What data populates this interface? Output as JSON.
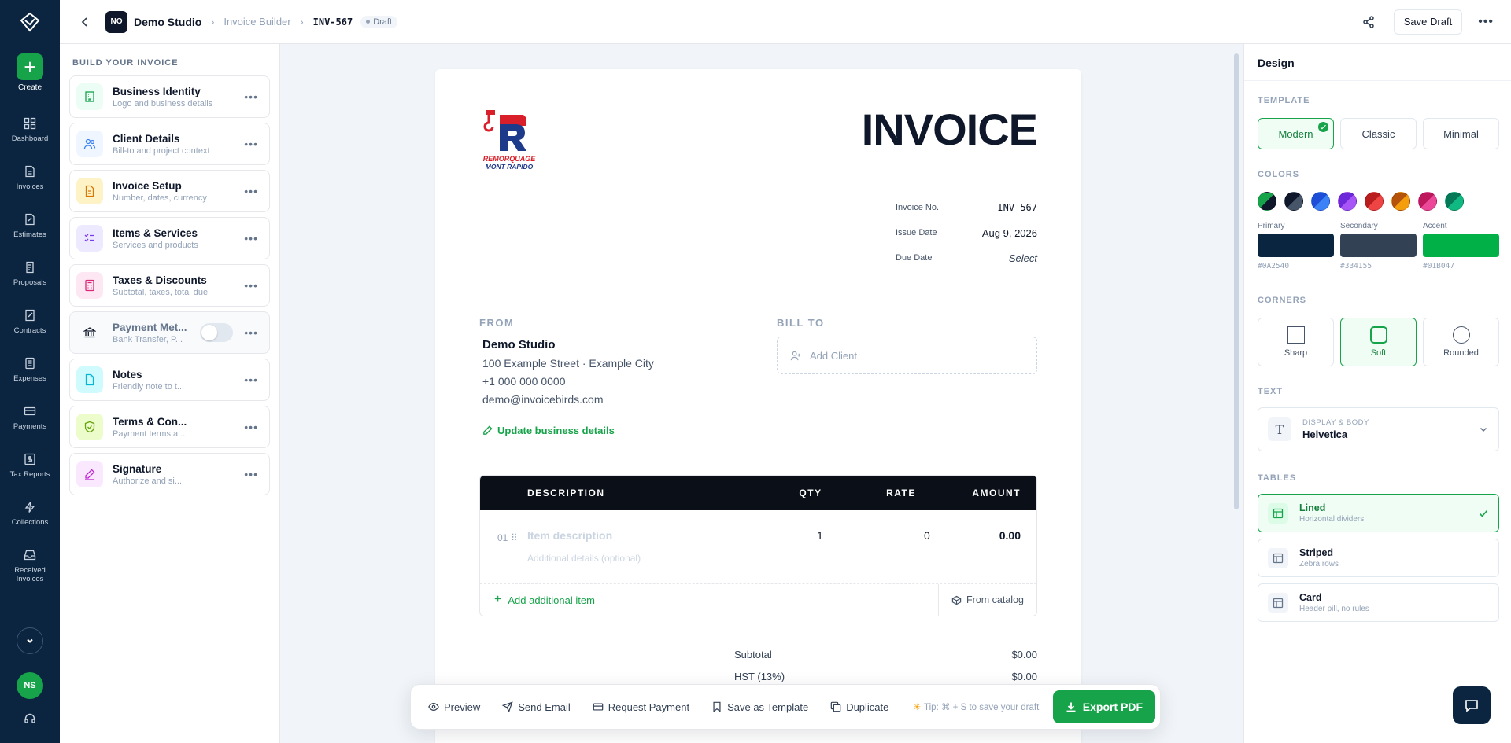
{
  "rail": {
    "create_label": "Create",
    "items": [
      {
        "label": "Dashboard",
        "icon": "dashboard-icon"
      },
      {
        "label": "Invoices",
        "icon": "invoice-icon"
      },
      {
        "label": "Estimates",
        "icon": "estimate-icon"
      },
      {
        "label": "Proposals",
        "icon": "proposal-icon"
      },
      {
        "label": "Contracts",
        "icon": "contract-icon"
      },
      {
        "label": "Expenses",
        "icon": "expense-icon"
      },
      {
        "label": "Payments",
        "icon": "card-icon"
      },
      {
        "label": "Tax Reports",
        "icon": "dollar-icon"
      },
      {
        "label": "Collections",
        "icon": "bolt-icon"
      },
      {
        "label": "Received Invoices",
        "icon": "inbox-icon"
      }
    ],
    "avatar_initials": "NS"
  },
  "topbar": {
    "org_initials": "NO",
    "org_name": "Demo Studio",
    "breadcrumb_builder": "Invoice Builder",
    "invoice_id": "INV-567",
    "status": "Draft",
    "save_draft_label": "Save Draft"
  },
  "build": {
    "title": "BUILD YOUR INVOICE",
    "items": [
      {
        "title": "Business Identity",
        "sub": "Logo and business details",
        "color": "#ecfdf5",
        "stroke": "#16a34a"
      },
      {
        "title": "Client Details",
        "sub": "Bill-to and project context",
        "color": "#eff6ff",
        "stroke": "#3b82f6"
      },
      {
        "title": "Invoice Setup",
        "sub": "Number, dates, currency",
        "color": "#fef3c7",
        "stroke": "#d97706"
      },
      {
        "title": "Items & Services",
        "sub": "Services and products",
        "color": "#ede9fe",
        "stroke": "#7c3aed"
      },
      {
        "title": "Taxes & Discounts",
        "sub": "Subtotal, taxes, total due",
        "color": "#fce7f3",
        "stroke": "#db2777"
      },
      {
        "title": "Payment Met...",
        "sub": "Bank Transfer, P...",
        "color": "#f8fafc",
        "stroke": "#0f172a"
      },
      {
        "title": "Notes",
        "sub": "Friendly note to t...",
        "color": "#cffafe",
        "stroke": "#06b6d4"
      },
      {
        "title": "Terms & Con...",
        "sub": "Payment terms a...",
        "color": "#ecfccb",
        "stroke": "#65a30d"
      },
      {
        "title": "Signature",
        "sub": "Authorize and si...",
        "color": "#fae8ff",
        "stroke": "#c026d3"
      }
    ]
  },
  "invoice": {
    "heading": "INVOICE",
    "logo_text_1": "REMORQUAGE",
    "logo_text_2": "MONT RAPIDO",
    "meta": [
      {
        "label": "Invoice No.",
        "value": "INV-567"
      },
      {
        "label": "Issue Date",
        "value": "Aug 9, 2026"
      },
      {
        "label": "Due Date",
        "value": "Select"
      }
    ],
    "from_label": "FROM",
    "bill_to_label": "BILL TO",
    "from": {
      "name": "Demo Studio",
      "address": "100 Example Street · Example City",
      "phone": "+1 000 000 0000",
      "email": "demo@invoicebirds.com"
    },
    "update_link": "Update business details",
    "add_client": "Add Client",
    "table": {
      "headers": {
        "description": "DESCRIPTION",
        "qty": "QTY",
        "rate": "RATE",
        "amount": "AMOUNT"
      },
      "row": {
        "num": "01",
        "description": "Item description",
        "details": "Additional details (optional)",
        "qty": "1",
        "rate": "0",
        "amount": "0.00"
      },
      "add_item": "Add additional item",
      "from_catalog": "From catalog"
    },
    "totals": [
      {
        "label": "Subtotal",
        "value": "$0.00"
      },
      {
        "label": "HST (13%)",
        "value": "$0.00"
      }
    ]
  },
  "actions": {
    "preview": "Preview",
    "send_email": "Send Email",
    "request_payment": "Request Payment",
    "save_template": "Save as Template",
    "duplicate": "Duplicate",
    "tip": "Tip: ⌘ + S to save your draft",
    "export": "Export PDF"
  },
  "design": {
    "title": "Design",
    "template_label": "TEMPLATE",
    "templates": [
      "Modern",
      "Classic",
      "Minimal"
    ],
    "colors_label": "COLORS",
    "swatches": [
      [
        "#16a34a",
        "#0f172a"
      ],
      [
        "#0f172a",
        "#475569"
      ],
      [
        "#1d4ed8",
        "#3b82f6"
      ],
      [
        "#6d28d9",
        "#a855f7"
      ],
      [
        "#b91c1c",
        "#ef4444"
      ],
      [
        "#b45309",
        "#f59e0b"
      ],
      [
        "#be185d",
        "#ec4899"
      ],
      [
        "#047857",
        "#10b981"
      ]
    ],
    "primary": {
      "label": "Primary",
      "hex": "#0A2540"
    },
    "secondary": {
      "label": "Secondary",
      "hex": "#334155"
    },
    "accent": {
      "label": "Accent",
      "hex": "#01B047"
    },
    "corners_label": "CORNERS",
    "corners": [
      "Sharp",
      "Soft",
      "Rounded"
    ],
    "text_label": "TEXT",
    "font_caption": "DISPLAY & BODY",
    "font_name": "Helvetica",
    "tables_label": "TABLES",
    "tables": [
      {
        "name": "Lined",
        "desc": "Horizontal dividers"
      },
      {
        "name": "Striped",
        "desc": "Zebra rows"
      },
      {
        "name": "Card",
        "desc": "Header pill, no rules"
      }
    ]
  }
}
